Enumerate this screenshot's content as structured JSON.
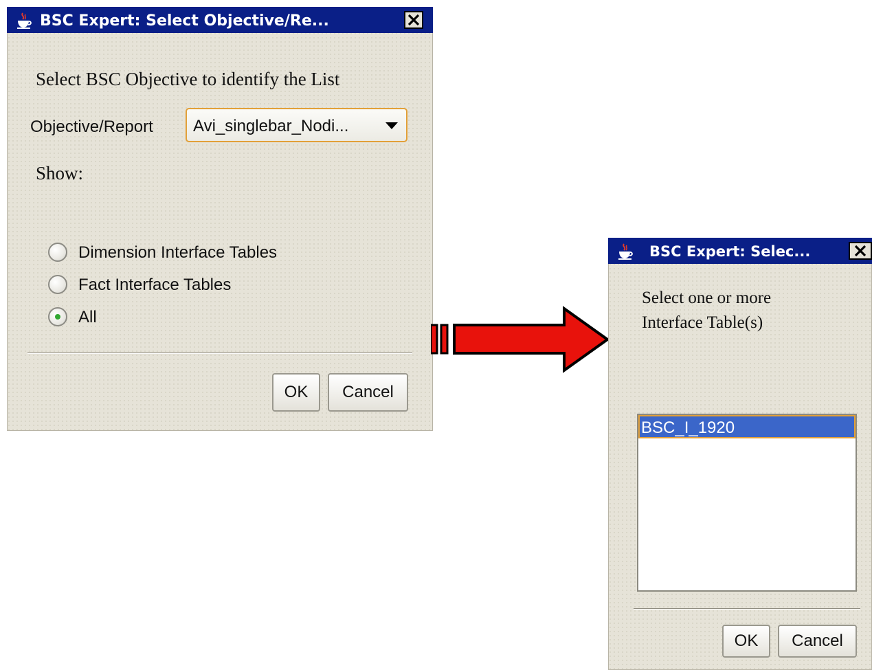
{
  "dialog_select_objective": {
    "title": "BSC Expert: Select Objective/Re...",
    "instruction": "Select BSC Objective to identify the List",
    "objective_label": "Objective/Report",
    "objective_value": "Avi_singlebar_Nodi...",
    "show_label": "Show:",
    "radio_options": [
      {
        "label": "Dimension Interface Tables",
        "selected": false
      },
      {
        "label": "Fact Interface Tables",
        "selected": false
      },
      {
        "label": "All",
        "selected": true
      }
    ],
    "ok_label": "OK",
    "cancel_label": "Cancel"
  },
  "dialog_select_tables": {
    "title": "BSC Expert: Selec...",
    "instruction_line1": "Select one or more",
    "instruction_line2": "Interface Table(s)",
    "list_items": [
      {
        "label": "BSC_I_1920",
        "selected": true
      }
    ],
    "ok_label": "OK",
    "cancel_label": "Cancel"
  },
  "colors": {
    "titlebar": "#0a1f87",
    "dialog_bg": "#e6e3d8",
    "arrow_fill": "#e8120c",
    "selection": "#3b66c9",
    "focus_border": "#e2a038"
  },
  "icons": {
    "window_icon": "java-cup-icon",
    "close": "close-x-icon",
    "combo_arrow": "triangle-down-icon",
    "flow": "right-arrow"
  }
}
